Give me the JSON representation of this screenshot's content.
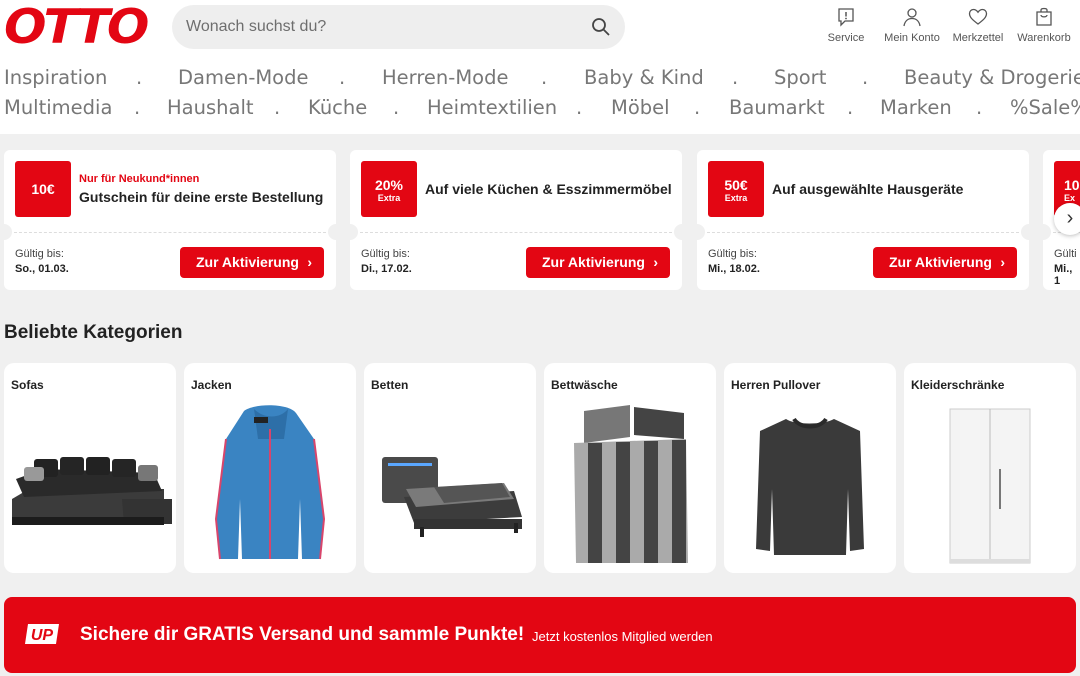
{
  "header": {
    "logo": "OTTO",
    "search_placeholder": "Wonach suchst du?",
    "icons": [
      {
        "label": "Service",
        "icon": "service-icon"
      },
      {
        "label": "Mein Konto",
        "icon": "account-icon"
      },
      {
        "label": "Merkzettel",
        "icon": "heart-icon"
      },
      {
        "label": "Warenkorb",
        "icon": "cart-icon"
      }
    ]
  },
  "nav": {
    "row1": [
      "Inspiration",
      "Damen-Mode",
      "Herren-Mode",
      "Baby & Kind",
      "Sport",
      "Beauty & Drogerie"
    ],
    "row2": [
      "Multimedia",
      "Haushalt",
      "Küche",
      "Heimtextilien",
      "Möbel",
      "Baumarkt",
      "Marken",
      "%Sale%"
    ],
    "separator": "."
  },
  "coupons": [
    {
      "badge": "10€",
      "badge_sub": "",
      "tag": "Nur für Neukund*innen",
      "title": "Gutschein für deine erste Bestellung",
      "valid_label": "Gültig bis:",
      "valid_date": "So., 01.03.",
      "button": "Zur Aktivierung"
    },
    {
      "badge": "20%",
      "badge_sub": "Extra",
      "tag": "",
      "title": "Auf viele Küchen & Esszimmermöbel",
      "valid_label": "Gültig bis:",
      "valid_date": "Di., 17.02.",
      "button": "Zur Aktivierung"
    },
    {
      "badge": "50€",
      "badge_sub": "Extra",
      "tag": "",
      "title": "Auf ausgewählte Hausgeräte",
      "valid_label": "Gültig bis:",
      "valid_date": "Mi., 18.02.",
      "button": "Zur Aktivierung"
    },
    {
      "badge": "10",
      "badge_sub": "Ex",
      "tag": "",
      "title": "",
      "valid_label": "Gülti",
      "valid_date": "Mi., 1",
      "button": ""
    }
  ],
  "categories": {
    "title": "Beliebte Kategorien",
    "items": [
      "Sofas",
      "Jacken",
      "Betten",
      "Bettwäsche",
      "Herren Pullover",
      "Kleiderschränke"
    ]
  },
  "banner": {
    "logo": "UP",
    "text": "Sichere dir GRATIS Versand und sammle Punkte!",
    "sub": "Jetzt kostenlos Mitglied werden"
  },
  "colors": {
    "brand": "#e30613",
    "background": "#f0f0f0"
  }
}
